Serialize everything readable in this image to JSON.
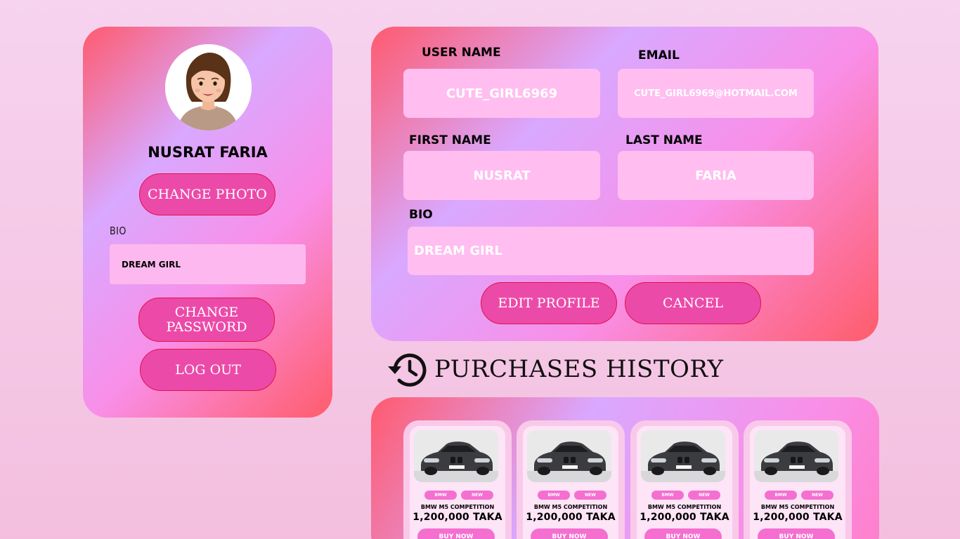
{
  "profile": {
    "display_name": "NUSRAT FARIA",
    "change_photo_label": "CHANGE PHOTO",
    "bio_label": "BIO",
    "bio_value": "DREAM GIRL",
    "change_password_label": "CHANGE PASSWORD",
    "logout_label": "LOG OUT"
  },
  "form": {
    "username_label": "USER NAME",
    "username_value": "CUTE_GIRL6969",
    "email_label": "EMAIL",
    "email_value": "CUTE_GIRL6969@HOTMAIL.COM",
    "firstname_label": "FIRST NAME",
    "firstname_value": "NUSRAT",
    "lastname_label": "LAST NAME",
    "lastname_value": "FARIA",
    "bio_label": "BIO",
    "bio_value": "DREAM GIRL",
    "edit_label": "EDIT PROFILE",
    "cancel_label": "CANCEL"
  },
  "history": {
    "title": "PURCHASES HISTORY",
    "icon": "history-icon",
    "items": [
      {
        "brand": "BMW",
        "badge": "NEW",
        "name": "BMW M5 COMPETITION",
        "price": "1,200,000 TAKA",
        "button": "BUY NOW"
      },
      {
        "brand": "BMW",
        "badge": "NEW",
        "name": "BMW M5 COMPETITION",
        "price": "1,200,000 TAKA",
        "button": "BUY NOW"
      },
      {
        "brand": "BMW",
        "badge": "NEW",
        "name": "BMW M5 COMPETITION",
        "price": "1,200,000 TAKA",
        "button": "BUY NOW"
      },
      {
        "brand": "BMW",
        "badge": "NEW",
        "name": "BMW M5 COMPETITION",
        "price": "1,200,000 TAKA",
        "button": "BUY NOW"
      }
    ]
  },
  "colors": {
    "accent_pink": "#ec4aa9",
    "button_border": "#e0124a",
    "field_bg": "#ffbdf0",
    "tag_pink": "#f46fd0"
  }
}
